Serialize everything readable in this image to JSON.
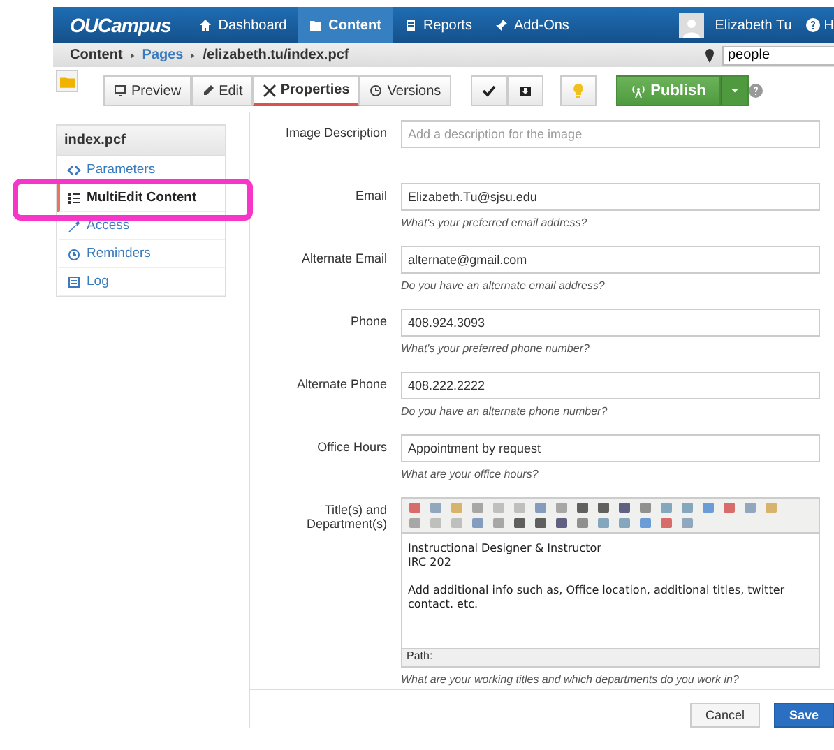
{
  "nav": {
    "logo": "OUCampus",
    "items": [
      {
        "label": "Dashboard",
        "selected": false
      },
      {
        "label": "Content",
        "selected": true
      },
      {
        "label": "Reports",
        "selected": false
      },
      {
        "label": "Add-Ons",
        "selected": false
      }
    ],
    "user": "Elizabeth Tu",
    "help": "H"
  },
  "breadcrumb": {
    "items": [
      {
        "label": "Content",
        "link": false
      },
      {
        "label": "Pages",
        "link": true
      },
      {
        "label": "/elizabeth.tu/index.pcf",
        "link": false
      }
    ],
    "search": "people"
  },
  "toolbar": {
    "tabs": [
      {
        "label": "Preview",
        "selected": false
      },
      {
        "label": "Edit",
        "selected": false
      },
      {
        "label": "Properties",
        "selected": true
      },
      {
        "label": "Versions",
        "selected": false
      }
    ],
    "publish": "Publish"
  },
  "sidebar": {
    "title": "index.pcf",
    "items": [
      {
        "label": "Parameters",
        "selected": false
      },
      {
        "label": "MultiEdit Content",
        "selected": true
      },
      {
        "label": "Access",
        "selected": false
      },
      {
        "label": "Reminders",
        "selected": false
      },
      {
        "label": "Log",
        "selected": false
      }
    ]
  },
  "fields": [
    {
      "kind": "input",
      "label": "Image Description",
      "placeholder": "Add a description for the image"
    },
    {
      "kind": "input",
      "label": "Email",
      "value": "Elizabeth.Tu@sjsu.edu",
      "hint": "What's your preferred email address?"
    },
    {
      "kind": "input",
      "label": "Alternate Email",
      "value": "alternate@gmail.com",
      "hint": "Do you have an alternate email address?"
    },
    {
      "kind": "input",
      "label": "Phone",
      "value": "408.924.3093",
      "hint": "What's your preferred phone number?"
    },
    {
      "kind": "input",
      "label": "Alternate Phone",
      "value": "408.222.2222",
      "hint": "Do you have an alternate phone number?"
    },
    {
      "kind": "input",
      "label": "Office Hours",
      "value": "Appointment by request",
      "hint": "What are your office hours?"
    },
    {
      "kind": "editor",
      "label": "Title(s) and Department(s)",
      "paragraphs": [
        [
          "Instructional Designer & Instructor",
          "IRC 202"
        ],
        [
          "Add additional info such as, Office location, additional titles, twitter contact. etc."
        ]
      ],
      "path": "Path:",
      "hint": "What are your working titles and which departments do you work in?"
    }
  ],
  "buttons": {
    "cancel": "Cancel",
    "save": "Save"
  }
}
